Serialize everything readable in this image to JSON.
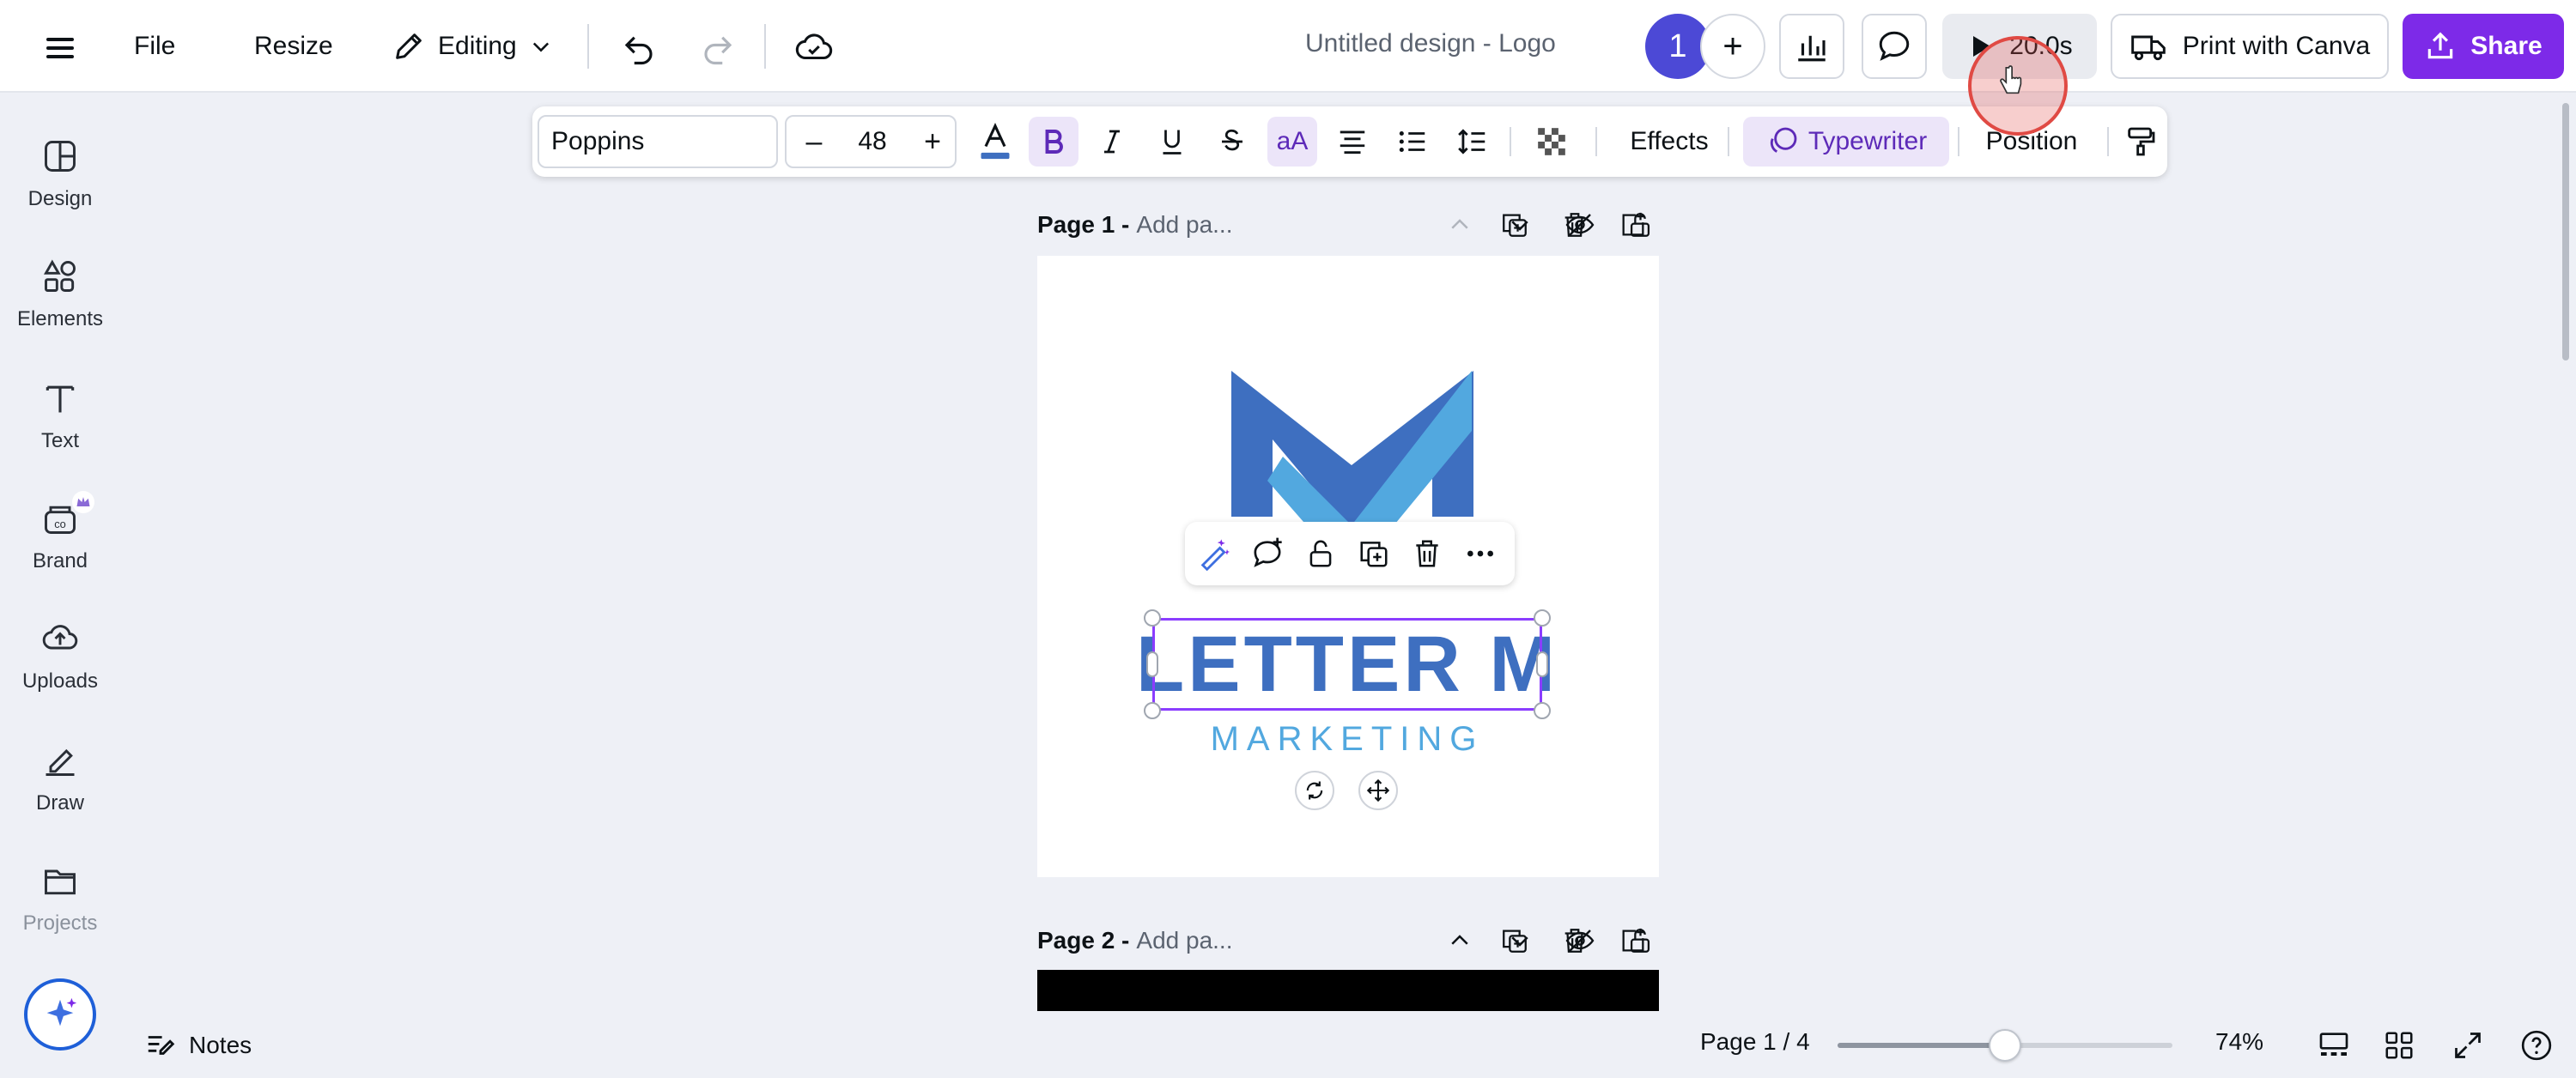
{
  "topbar": {
    "file_label": "File",
    "resize_label": "Resize",
    "editing_label": "Editing",
    "doc_title": "Untitled design - Logo",
    "avatar_label": "1",
    "add_label": "+",
    "present_time": "20.0s",
    "print_label": "Print with Canva",
    "share_label": "Share"
  },
  "sidebar": {
    "items": [
      {
        "label": "Design",
        "icon": "design-icon"
      },
      {
        "label": "Elements",
        "icon": "elements-icon"
      },
      {
        "label": "Text",
        "icon": "text-icon"
      },
      {
        "label": "Brand",
        "icon": "brand-icon"
      },
      {
        "label": "Uploads",
        "icon": "uploads-icon"
      },
      {
        "label": "Draw",
        "icon": "draw-icon"
      },
      {
        "label": "Projects",
        "icon": "projects-icon"
      }
    ]
  },
  "text_toolbar": {
    "font": "Poppins",
    "size_minus": "–",
    "size": "48",
    "size_plus": "+",
    "effects_label": "Effects",
    "typewriter_label": "Typewriter",
    "position_label": "Position"
  },
  "pages": [
    {
      "label": "Page 1 -",
      "title_placeholder": "Add pa..."
    },
    {
      "label": "Page 2 -",
      "title_placeholder": "Add pa..."
    }
  ],
  "design": {
    "headline": "LETTER M",
    "tagline": "MARKETING"
  },
  "bottombar": {
    "notes_label": "Notes",
    "page_counter": "Page 1 / 4",
    "zoom_label": "74%",
    "zoom_fraction": 0.5
  },
  "colors": {
    "accent": "#7d2ae8",
    "logo_dark_blue": "#3e6fc0",
    "logo_light_blue": "#52a8df",
    "selection": "#8b3dff"
  }
}
